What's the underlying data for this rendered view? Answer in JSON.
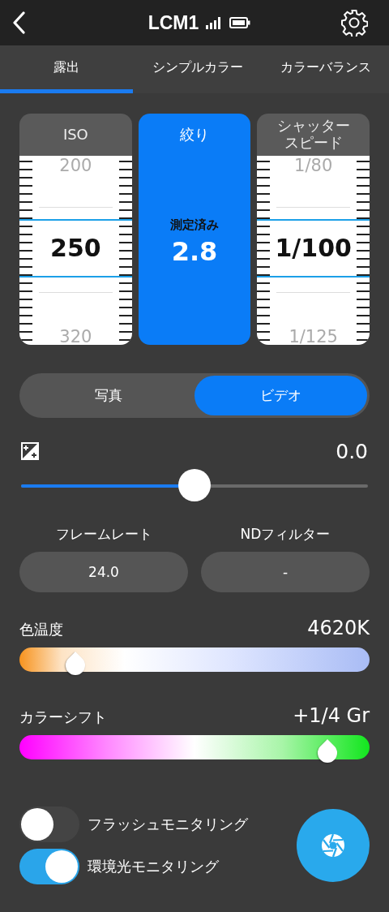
{
  "header": {
    "title": "LCM1"
  },
  "tabs": [
    {
      "label": "露出",
      "selected": true
    },
    {
      "label": "シンプルカラー",
      "selected": false
    },
    {
      "label": "カラーバランス",
      "selected": false
    }
  ],
  "dials": [
    {
      "label": "ISO",
      "selected": false,
      "above": "200",
      "value": "250",
      "below": "320"
    },
    {
      "label": "絞り",
      "selected": true,
      "status": "測定済み",
      "value": "2.8"
    },
    {
      "label": "シャッタースピード",
      "selected": false,
      "above": "1/80",
      "value": "1/100",
      "below": "1/125"
    }
  ],
  "modes": [
    {
      "label": "写真",
      "selected": false
    },
    {
      "label": "ビデオ",
      "selected": true
    }
  ],
  "exposure_compensation": {
    "value": "0.0",
    "level": 0.5
  },
  "fields": [
    {
      "label": "フレームレート",
      "value": "24.0"
    },
    {
      "label": "NDフィルター",
      "value": "-"
    }
  ],
  "color_sliders": [
    {
      "kind": "temperature",
      "label": "色温度",
      "value": "4620K",
      "level": 0.16
    },
    {
      "kind": "tint",
      "label": "カラーシフト",
      "value": "+1/4 Gr",
      "level": 0.88
    }
  ],
  "toggles": [
    {
      "label": "フラッシュモニタリング",
      "on": false
    },
    {
      "label": "環境光モニタリング",
      "on": true
    }
  ]
}
